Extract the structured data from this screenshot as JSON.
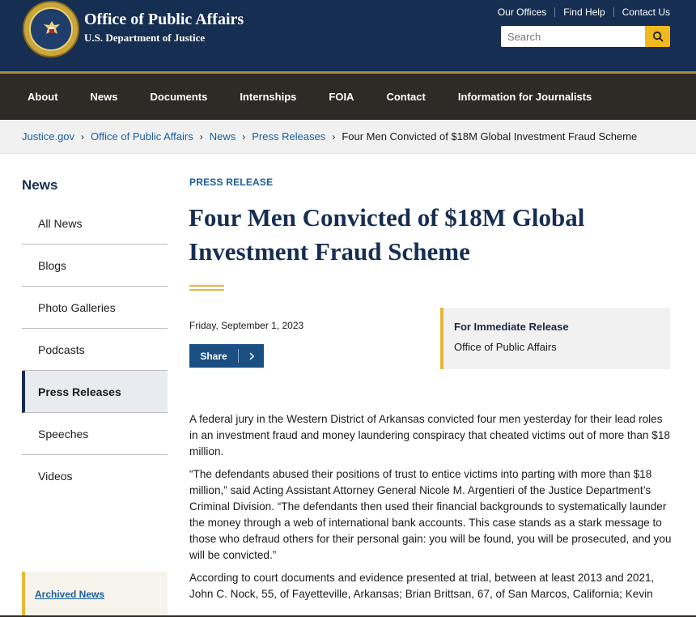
{
  "header": {
    "title": "Office of Public Affairs",
    "subtitle": "U.S. Department of Justice",
    "seal_icon": "doj-seal-icon",
    "utility_links": [
      "Our Offices",
      "Find Help",
      "Contact Us"
    ],
    "search": {
      "placeholder": "Search",
      "icon": "search-icon"
    }
  },
  "nav": {
    "items": [
      "About",
      "News",
      "Documents",
      "Internships",
      "FOIA",
      "Contact",
      "Information for Journalists"
    ]
  },
  "breadcrumb": {
    "links": [
      "Justice.gov",
      "Office of Public Affairs",
      "News",
      "Press Releases"
    ],
    "current": "Four Men Convicted of $18M Global Investment Fraud Scheme",
    "separator": "›"
  },
  "sidebar": {
    "heading": "News",
    "items": [
      "All News",
      "Blogs",
      "Photo Galleries",
      "Podcasts",
      "Press Releases",
      "Speeches",
      "Videos"
    ],
    "active": "Press Releases",
    "archived": "Archived News"
  },
  "article": {
    "eyebrow": "PRESS RELEASE",
    "title_line1": "Four Men Convicted of $18M Global",
    "title_line2": "Investment Fraud Scheme",
    "date": "Friday, September 1, 2023",
    "share_label": "Share",
    "release_title": "For Immediate Release",
    "release_office": "Office of Public Affairs",
    "paragraphs": [
      "A federal jury in the Western District of Arkansas convicted four men yesterday for their lead roles in an investment fraud and money laundering conspiracy that cheated victims out of more than $18 million.",
      "“The defendants abused their positions of trust to entice victims into parting with more than $18 million,” said Acting Assistant Attorney General Nicole M. Argentieri of the Justice Department’s Criminal Division. “The defendants then used their financial backgrounds to systematically launder the money through a web of international bank accounts. This case stands as a stark message to those who defraud others for their personal gain: you will be found, you will be prosecuted, and you will be convicted.”",
      "According to court documents and evidence presented at trial, between at least 2013 and 2021, John C. Nock, 55, of Fayetteville, Arkansas; Brian Brittsan, 67, of San Marcos, California; Kevin"
    ]
  },
  "colors": {
    "header_navy": "#162e51",
    "nav_dark": "#2e2b26",
    "gold": "#e4b83a",
    "link_blue": "#1a5e9e",
    "share_blue": "#1a4f82"
  }
}
